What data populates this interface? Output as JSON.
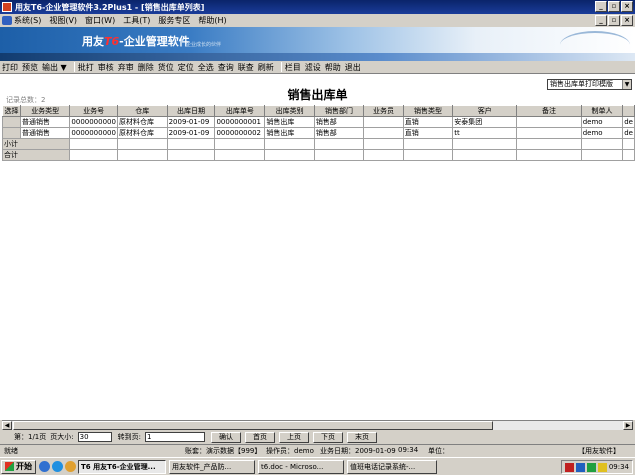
{
  "window": {
    "title": "用友T6-企业管理软件3.2Plus1 - [销售出库单列表]"
  },
  "menu": {
    "items": [
      "系统(S)",
      "视图(V)",
      "窗口(W)",
      "工具(T)",
      "服务专区",
      "帮助(H)"
    ]
  },
  "banner": {
    "logo_brand": "用友",
    "logo_t6": "T6",
    "logo_text": "-企业管理软件",
    "sub": "企业成长的伙伴"
  },
  "toolbar": {
    "print": "打印",
    "preview": "预览",
    "export": "输出 ▼",
    "batch": "批打",
    "audit": "审核",
    "unaudit": "弃审",
    "delete": "删除",
    "locate_goods": "货位",
    "locate": "定位",
    "select_all": "全选",
    "query": "查询",
    "related": "联查",
    "refresh": "刷新",
    "column": "栏目",
    "filter": "滤设",
    "help": "帮助",
    "exit": "退出"
  },
  "content": {
    "print_template": "销售出库单打印模版",
    "record_count": "记录总数：2",
    "title": "销售出库单"
  },
  "grid": {
    "columns": [
      "选择",
      "业务类型",
      "业务号",
      "仓库",
      "出库日期",
      "出库单号",
      "出库类别",
      "销售部门",
      "业务员",
      "销售类型",
      "客户",
      "备注",
      "制单人",
      ""
    ],
    "rows": [
      [
        "",
        "普通销售",
        "0000000000",
        "原材料仓库",
        "2009-01-09",
        "0000000001",
        "销售出库",
        "销售部",
        "",
        "直销",
        "安泰集团",
        "",
        "demo",
        "de"
      ],
      [
        "",
        "普通销售",
        "0000000000",
        "原材料仓库",
        "2009-01-09",
        "0000000002",
        "销售出库",
        "销售部",
        "",
        "直销",
        "tt",
        "",
        "demo",
        "de"
      ]
    ],
    "subtotal": "小计",
    "total": "合计"
  },
  "pager": {
    "page": "第：1/1页",
    "page_size_label": "页大小:",
    "page_size": "30",
    "goto_label": "转到页:",
    "goto_page": "1",
    "confirm": "确认",
    "first": "首页",
    "prev": "上页",
    "next": "下页",
    "last": "末页"
  },
  "status": {
    "ready": "就绪",
    "account": "账套：演示数据【999】",
    "operator": "操作员：demo",
    "biz_date": "业务日期：2009-01-09",
    "time": "09:34",
    "unit": "单位：",
    "brand": "【用友软件】"
  },
  "taskbar": {
    "start": "开始",
    "tasks": [
      "T6 用友T6-企业管理...",
      "用友软件_产品防...",
      "t6.doc - Microso...",
      "值班电话记录系统-..."
    ],
    "clock": "09:34"
  }
}
